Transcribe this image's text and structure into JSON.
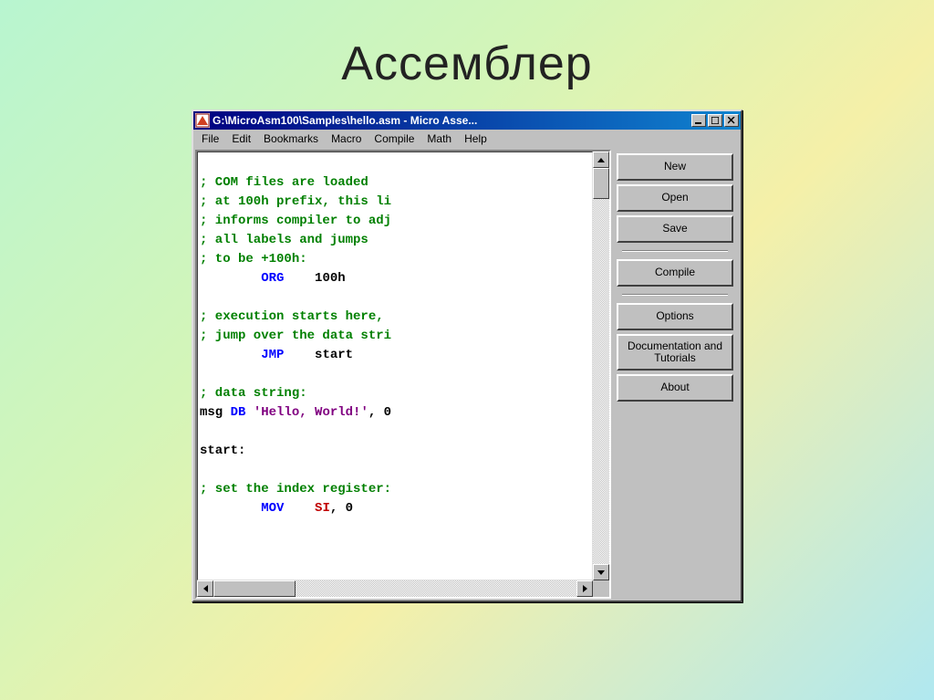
{
  "slide": {
    "title": "Ассемблер"
  },
  "window": {
    "title": "G:\\MicroAsm100\\Samples\\hello.asm - Micro Asse...",
    "menu": [
      "File",
      "Edit",
      "Bookmarks",
      "Macro",
      "Compile",
      "Math",
      "Help"
    ],
    "buttons": {
      "new": "New",
      "open": "Open",
      "save": "Save",
      "compile": "Compile",
      "options": "Options",
      "docs": "Documentation and Tutorials",
      "about": "About"
    }
  },
  "code": {
    "l1": "; COM files are loaded",
    "l2": "; at 100h prefix, this li",
    "l3": "; informs compiler to adj",
    "l4": "; all labels and jumps",
    "l5": "; to be +100h:",
    "l6a": "        ",
    "l6b": "ORG",
    "l6c": "    100h",
    "l7": "",
    "l8": "; execution starts here,",
    "l9": "; jump over the data stri",
    "l10a": "        ",
    "l10b": "JMP",
    "l10c": "    start",
    "l11": "",
    "l12": "; data string:",
    "l13a": "msg ",
    "l13b": "DB",
    "l13c": " ",
    "l13d": "'Hello, World!'",
    "l13e": ", 0",
    "l14": "",
    "l15": "start:",
    "l16": "",
    "l17": "; set the index register:",
    "l18a": "        ",
    "l18b": "MOV",
    "l18c": "    ",
    "l18d": "SI",
    "l18e": ", 0"
  }
}
